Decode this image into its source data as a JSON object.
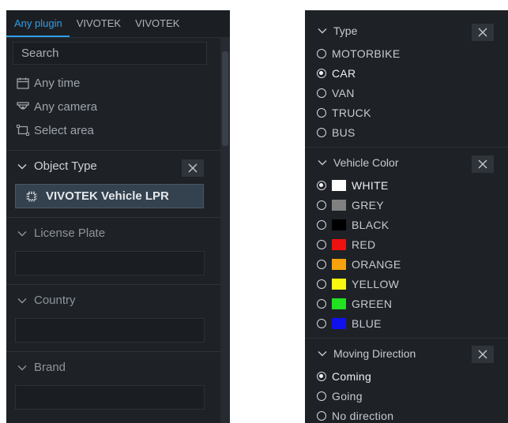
{
  "left": {
    "tabs": [
      "Any plugin",
      "VIVOTEK",
      "VIVOTEK"
    ],
    "search_placeholder": "Search",
    "filters": [
      {
        "icon": "calendar-icon",
        "label": "Any time"
      },
      {
        "icon": "camera-icon",
        "label": "Any camera"
      },
      {
        "icon": "select-area-icon",
        "label": "Select area"
      }
    ],
    "object_type": {
      "label": "Object Type",
      "chip": "VIVOTEK Vehicle LPR",
      "chip_icon": "chip-icon"
    },
    "license_plate": {
      "label": "License Plate",
      "value": ""
    },
    "country": {
      "label": "Country",
      "value": ""
    },
    "brand": {
      "label": "Brand",
      "value": ""
    }
  },
  "right": {
    "type": {
      "label": "Type",
      "options": [
        "MOTORBIKE",
        "CAR",
        "VAN",
        "TRUCK",
        "BUS"
      ],
      "selected": "CAR"
    },
    "vehicle_color": {
      "label": "Vehicle Color",
      "options": [
        {
          "label": "WHITE",
          "color": "#ffffff"
        },
        {
          "label": "GREY",
          "color": "#808080"
        },
        {
          "label": "BLACK",
          "color": "#000000"
        },
        {
          "label": "RED",
          "color": "#ee1111"
        },
        {
          "label": "ORANGE",
          "color": "#f5a20d"
        },
        {
          "label": "YELLOW",
          "color": "#f7f711"
        },
        {
          "label": "GREEN",
          "color": "#22e022"
        },
        {
          "label": "BLUE",
          "color": "#1111ee"
        }
      ],
      "selected": "WHITE"
    },
    "moving_direction": {
      "label": "Moving Direction",
      "options": [
        "Coming",
        "Going",
        "No direction"
      ],
      "selected": "Coming"
    }
  },
  "colors": {
    "panel_bg": "#1e2227",
    "accent": "#2f9ee8",
    "chip_bg": "#34414f"
  }
}
